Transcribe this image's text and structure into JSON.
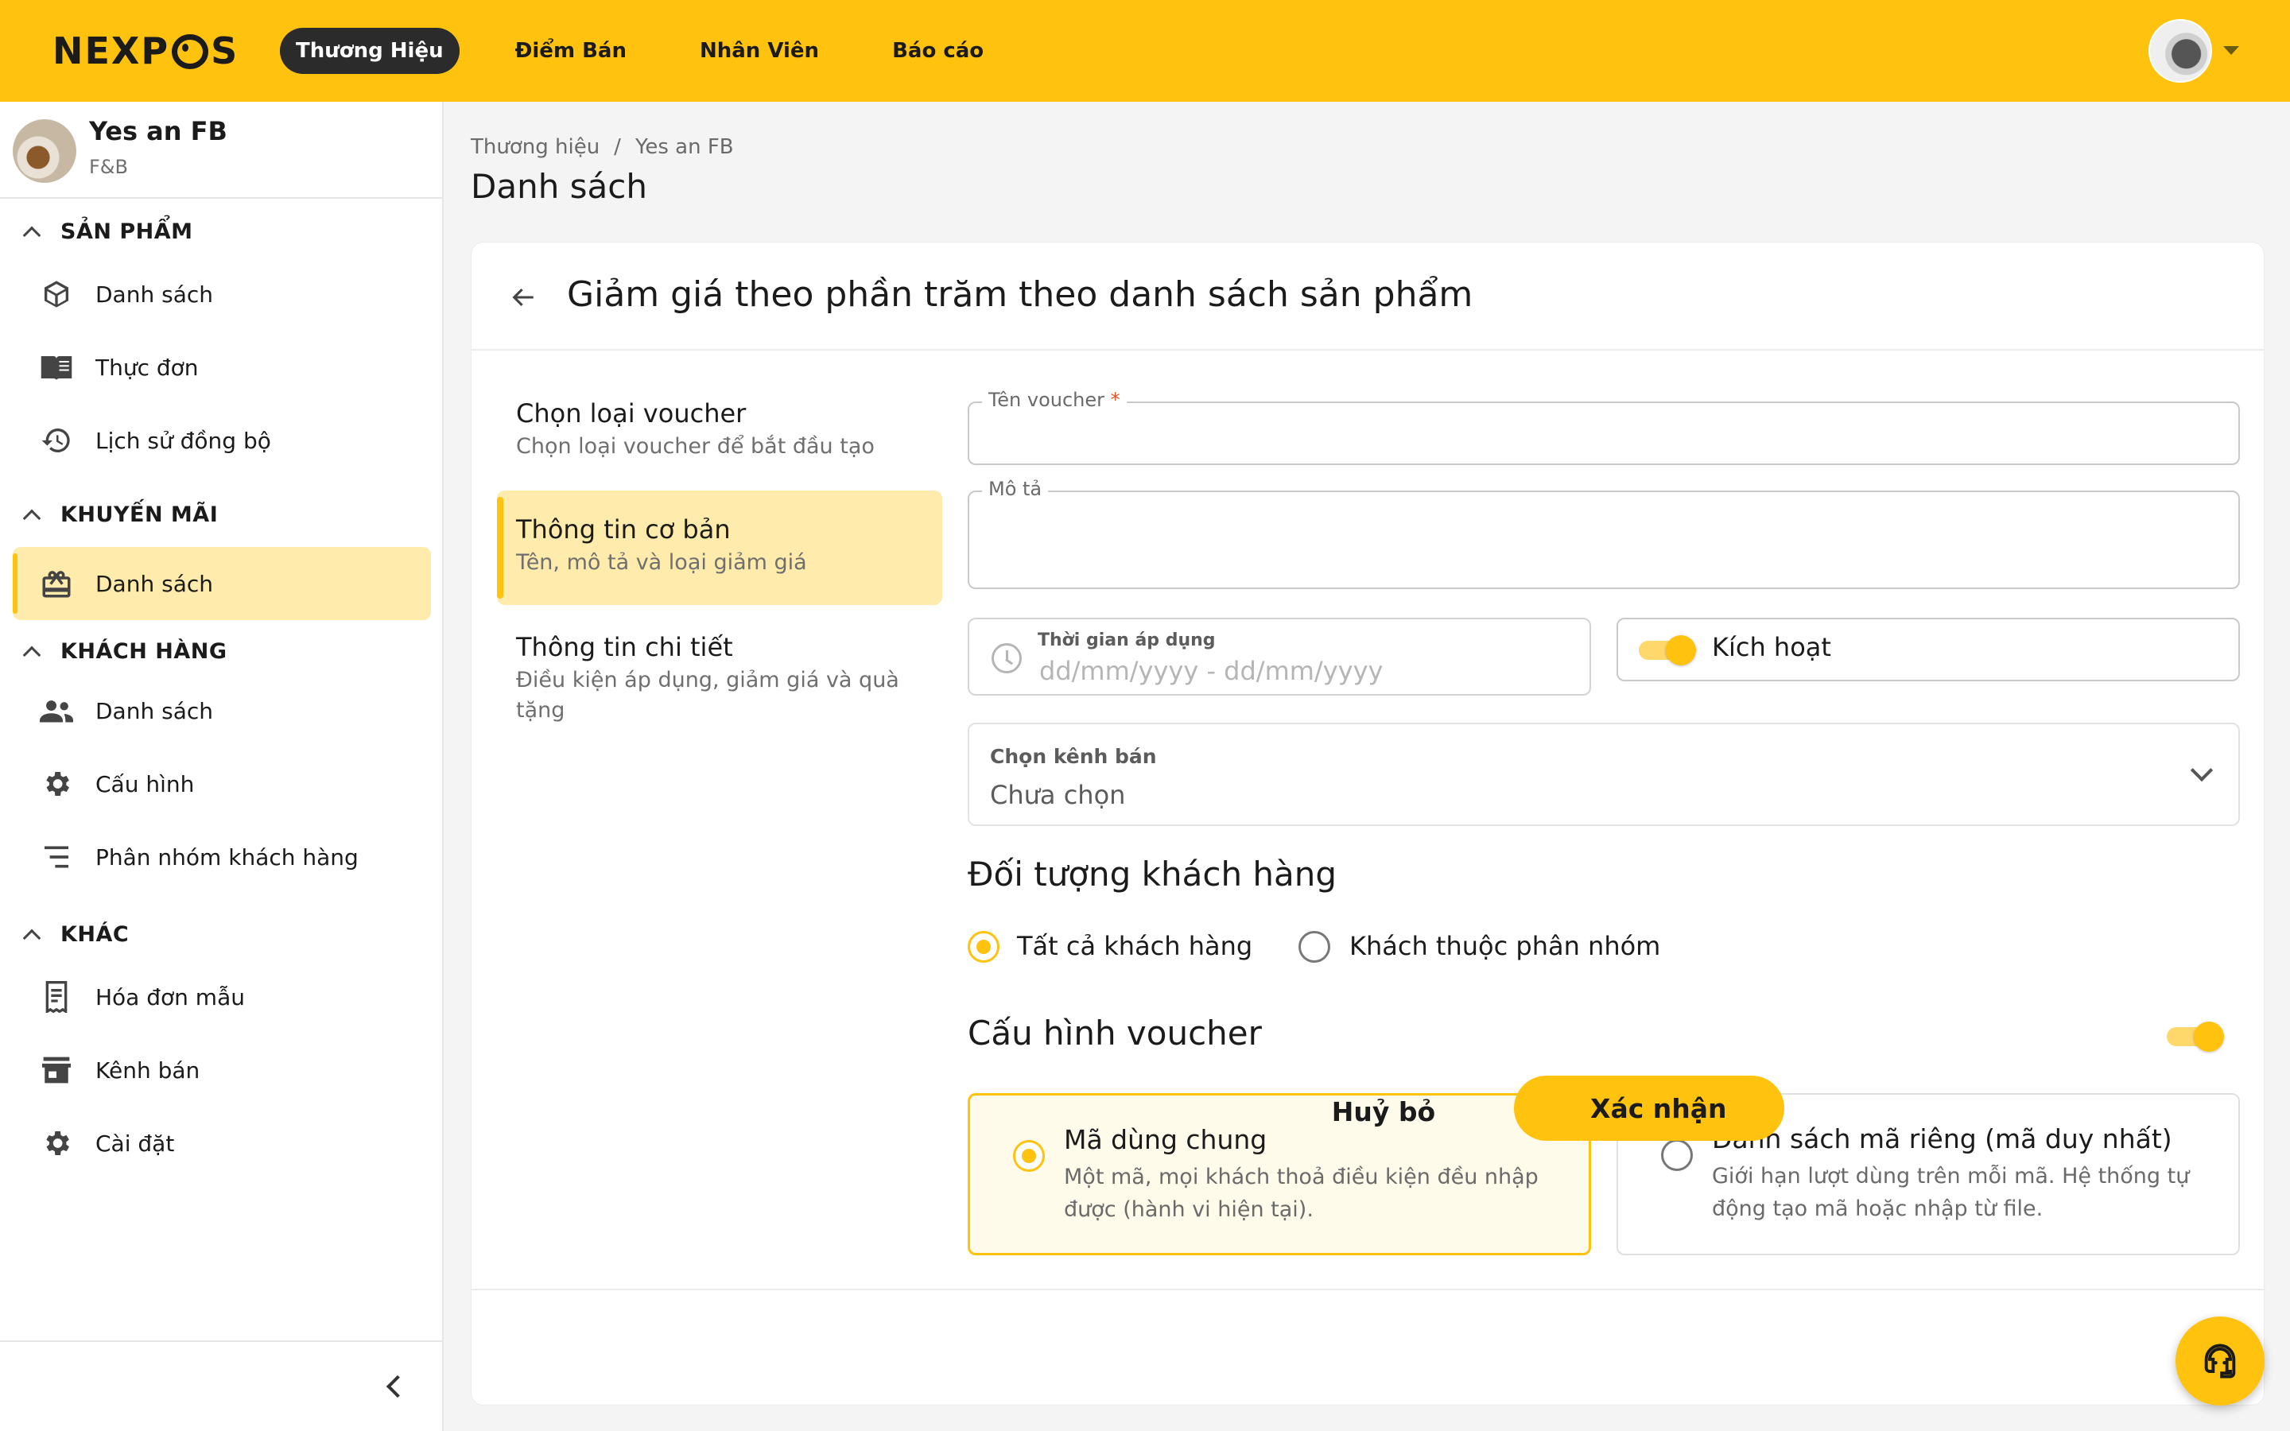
{
  "topbar": {
    "logo": "NEXPOS",
    "nav": [
      "Thương Hiệu",
      "Điểm Bán",
      "Nhân Viên",
      "Báo cáo"
    ],
    "active_nav": "Thương Hiệu"
  },
  "sidebar": {
    "brand_name": "Yes an FB",
    "brand_type": "F&B",
    "sections": [
      {
        "label": "SẢN PHẨM",
        "items": [
          "Danh sách",
          "Thực đơn",
          "Lịch sử đồng bộ"
        ]
      },
      {
        "label": "KHUYẾN MÃI",
        "items": [
          "Danh sách"
        ]
      },
      {
        "label": "KHÁCH HÀNG",
        "items": [
          "Danh sách",
          "Cấu hình",
          "Phân nhóm khách hàng"
        ]
      },
      {
        "label": "KHÁC",
        "items": [
          "Hóa đơn mẫu",
          "Kênh bán",
          "Cài đặt"
        ]
      }
    ]
  },
  "breadcrumb": [
    "Thương hiệu",
    "/",
    "Yes an FB"
  ],
  "page_title": "Danh sách",
  "card": {
    "title": "Giảm giá theo phần trăm theo danh sách sản phẩm",
    "steps": [
      {
        "title": "Chọn loại voucher",
        "desc": "Chọn loại voucher để bắt đầu tạo"
      },
      {
        "title": "Thông tin cơ bản",
        "desc": "Tên, mô tả và loại giảm giá"
      },
      {
        "title": "Thông tin chi tiết",
        "desc": "Điều kiện áp dụng, giảm giá và quà tặng"
      }
    ],
    "form": {
      "voucher_name_label": "Tên voucher",
      "required_mark": "*",
      "voucher_name_value": "",
      "description_label": "Mô tả",
      "description_value": "",
      "date_label": "Thời gian áp dụng",
      "date_placeholder": "dd/mm/yyyy - dd/mm/yyyy",
      "active_label": "Kích hoạt",
      "active_on": true,
      "channel_label": "Chọn kênh bán",
      "channel_value": "Chưa chọn",
      "audience_title": "Đối tượng khách hàng",
      "audience_options": [
        "Tất cả khách hàng",
        "Khách thuộc phân nhóm"
      ],
      "audience_selected": "Tất cả khách hàng",
      "config_title": "Cấu hình voucher",
      "config_on": true,
      "config_options": [
        {
          "title": "Mã dùng chung",
          "desc": "Một mã, mọi khách thoả điều kiện đều nhập được (hành vi hiện tại).",
          "selected": true
        },
        {
          "title": "Danh sách mã riêng (mã duy nhất)",
          "desc": "Giới hạn lượt dùng trên mỗi mã. Hệ thống tự động tạo mã hoặc nhập từ file.",
          "selected": false
        }
      ]
    },
    "footer": {
      "cancel": "Huỷ bỏ",
      "confirm": "Xác nhận"
    }
  },
  "colors": {
    "accent": "#ffc20e",
    "accent_light": "#ffebab",
    "dark": "#2b2b2b"
  }
}
